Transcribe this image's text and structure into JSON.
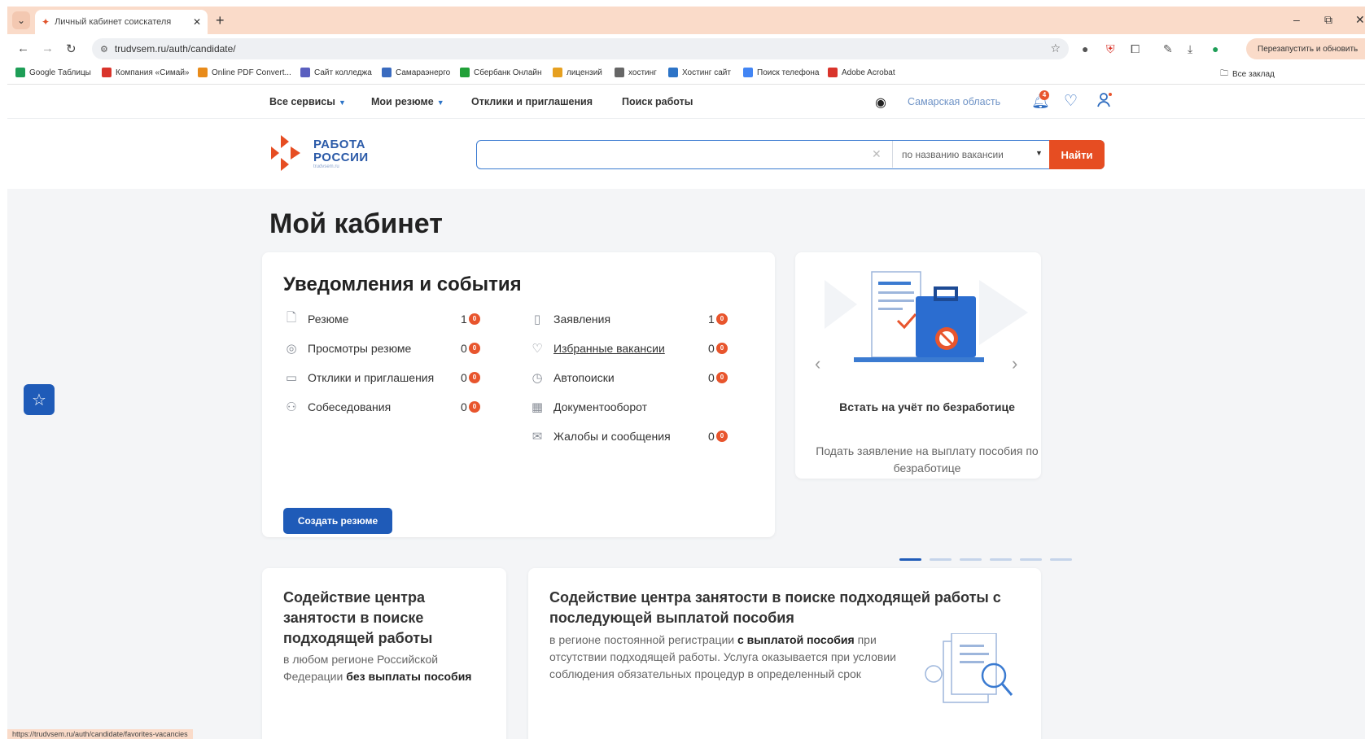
{
  "browser": {
    "tab_title": "Личный кабинет соискателя",
    "url": "trudvsem.ru/auth/candidate/",
    "restart_label": "Перезапустить и обновить",
    "bookmarks": [
      {
        "label": "Google Таблицы",
        "color": "#1e9e57"
      },
      {
        "label": "Компания «Симай»",
        "color": "#d9342b"
      },
      {
        "label": "Online PDF Convert...",
        "color": "#e88b1a"
      },
      {
        "label": "Сайт колледжа",
        "color": "#5a5fbf"
      },
      {
        "label": "Самараэнерго",
        "color": "#3a6bbf"
      },
      {
        "label": "Сбербанк Онлайн",
        "color": "#21a038"
      },
      {
        "label": "лицензий",
        "color": "#e6a020"
      },
      {
        "label": "хостинг",
        "color": "#666666"
      },
      {
        "label": "Хостинг сайт",
        "color": "#2d74c7"
      },
      {
        "label": "Поиск телефона",
        "color": "#4285f4"
      },
      {
        "label": "Adobe Acrobat",
        "color": "#d9342b"
      }
    ],
    "all_bookmarks_label": "Все заклад",
    "status_url": "https://trudvsem.ru/auth/candidate/favorites-vacancies"
  },
  "site": {
    "nav": {
      "all_services": "Все сервисы",
      "my_resumes": "Мои резюме",
      "responses": "Отклики и приглашения",
      "job_search": "Поиск работы",
      "region": "Самарская область",
      "bell_count": "4"
    },
    "logo": {
      "line1": "РАБОТА",
      "line2": "РОССИИ",
      "sub": "trudvsem.ru"
    },
    "search": {
      "placeholder": "",
      "mode": "по названию вакансии",
      "button": "Найти"
    },
    "brand_color": "#1f5bb8",
    "accent_color": "#e64d22"
  },
  "main": {
    "title": "Мой кабинет",
    "notifications": {
      "title": "Уведомления и события",
      "left": [
        {
          "label": "Резюме",
          "count": "1",
          "icon": "document-icon"
        },
        {
          "label": "Просмотры резюме",
          "count": "0",
          "icon": "eye-icon"
        },
        {
          "label": "Отклики и приглашения",
          "count": "0",
          "icon": "chat-icon"
        },
        {
          "label": "Собеседования",
          "count": "0",
          "icon": "people-icon"
        }
      ],
      "right": [
        {
          "label": "Заявления",
          "count": "1",
          "icon": "clipboard-icon"
        },
        {
          "label": "Избранные вакансии",
          "count": "0",
          "icon": "heart-icon"
        },
        {
          "label": "Автопоиски",
          "count": "0",
          "icon": "autosearch-icon"
        },
        {
          "label": "Документооборот",
          "count": "",
          "icon": "calendar-icon"
        },
        {
          "label": "Жалобы и сообщения",
          "count": "0",
          "icon": "envelope-icon"
        }
      ],
      "badge_symbol": "0",
      "create_button": "Создать резюме"
    },
    "promo": {
      "title": "Встать на учёт по безработице",
      "text": "Подать заявление на выплату пособия по безработице",
      "slides": 6,
      "active_slide": 1
    },
    "bottom_left": {
      "title": "Содействие центра занятости в поиске подходящей работы",
      "text_prefix": "в любом регионе Российской Федерации ",
      "text_bold": "без выплаты пособия"
    },
    "bottom_right": {
      "title": "Содействие центра занятости в поиске подходящей работы с последующей выплатой пособия",
      "text_prefix": "в регионе постоянной регистрации ",
      "text_bold": "с выплатой пособия",
      "text_suffix": " при отсутствии подходящей работы. Услуга оказывается при условии соблюдения обязательных процедур в определенный срок"
    }
  }
}
